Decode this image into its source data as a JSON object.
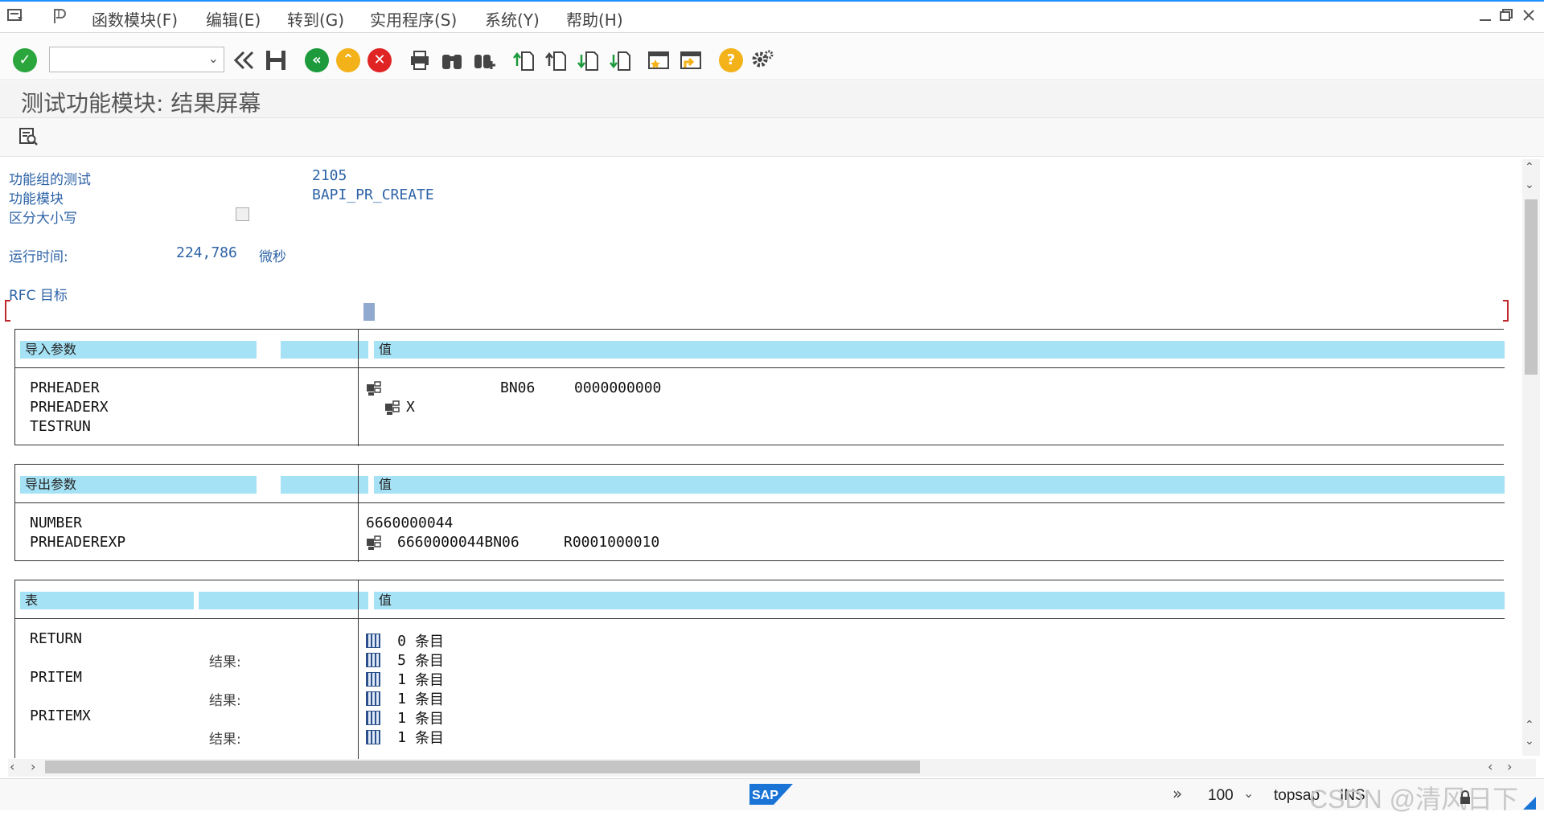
{
  "menubar": {
    "items": [
      "函数模块(F)",
      "编辑(E)",
      "转到(G)",
      "实用程序(S)",
      "系统(Y)",
      "帮助(H)"
    ]
  },
  "toolbar": {
    "command_value": ""
  },
  "title": "测试功能模块: 结果屏幕",
  "info": {
    "function_group_label": "功能组的测试",
    "function_group_value": "2105",
    "function_module_label": "功能模块",
    "function_module_value": "BAPI_PR_CREATE",
    "case_sensitive_label": "区分大小写",
    "runtime_label": "运行时间:",
    "runtime_value": "224,786",
    "runtime_unit": "微秒",
    "rfc_label": "RFC 目标"
  },
  "import": {
    "header": "导入参数",
    "value_header": "值",
    "params": [
      "PRHEADER",
      "PRHEADERX",
      "TESTRUN"
    ],
    "prheader_v1": "BN06",
    "prheader_v2": "0000000000",
    "prheaderx_v": "X"
  },
  "export": {
    "header": "导出参数",
    "value_header": "值",
    "params": [
      "NUMBER",
      "PRHEADEREXP"
    ],
    "number_value": "6660000044",
    "exp_v1": "6660000044BN06",
    "exp_v2": "R0001000010"
  },
  "tables": {
    "header": "表",
    "value_header": "值",
    "result_label": "结果:",
    "names": [
      "RETURN",
      "PRITEM",
      "PRITEMX"
    ],
    "counts": [
      "0",
      "5",
      "1",
      "1",
      "1",
      "1"
    ],
    "entries_label": "条目"
  },
  "status": {
    "zoom": "100",
    "system": "topsap",
    "mode": "INS",
    "watermark": "CSDN @清风日下"
  },
  "colors": {
    "accent": "#1e90ff",
    "header_bar": "#a6e2f5",
    "label_blue": "#2e63a6",
    "ok_green": "#2aa63d",
    "nav_green": "#1c9a3c",
    "cancel_red": "#e02424",
    "help_yellow": "#f3b21a"
  }
}
